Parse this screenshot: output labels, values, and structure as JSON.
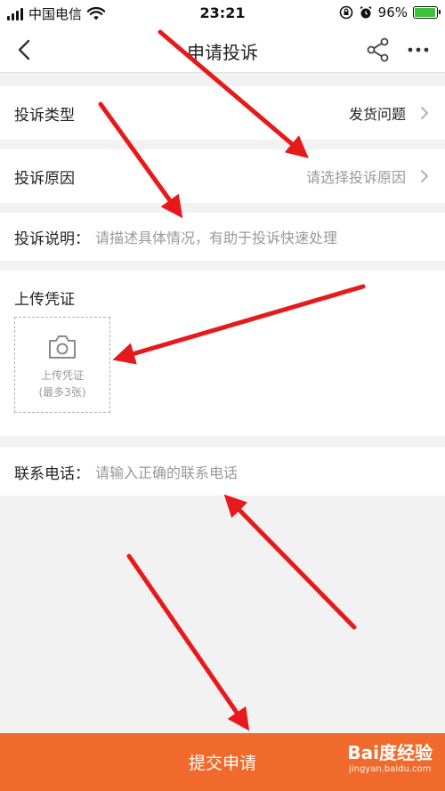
{
  "status_bar": {
    "carrier": "中国电信",
    "time": "23:21",
    "battery_percent": "96%",
    "battery_level": 0.96
  },
  "nav": {
    "title": "申请投诉"
  },
  "form": {
    "complaint_type": {
      "label": "投诉类型",
      "value": "发货问题"
    },
    "complaint_reason": {
      "label": "投诉原因",
      "placeholder": "请选择投诉原因"
    },
    "complaint_desc": {
      "label": "投诉说明：",
      "placeholder": "请描述具体情况，有助于投诉快速处理"
    },
    "upload": {
      "title": "上传凭证",
      "box_line1": "上传凭证",
      "box_line2": "(最多3张)"
    },
    "contact_phone": {
      "label": "联系电话：",
      "placeholder": "请输入正确的联系电话"
    }
  },
  "submit": {
    "label": "提交申请"
  },
  "watermark": {
    "text": "Bai度经验",
    "sub": "jingyan.baidu.com"
  },
  "colors": {
    "accent": "#f06a2b",
    "annotation_arrow": "#e8191b",
    "placeholder": "#999999"
  }
}
